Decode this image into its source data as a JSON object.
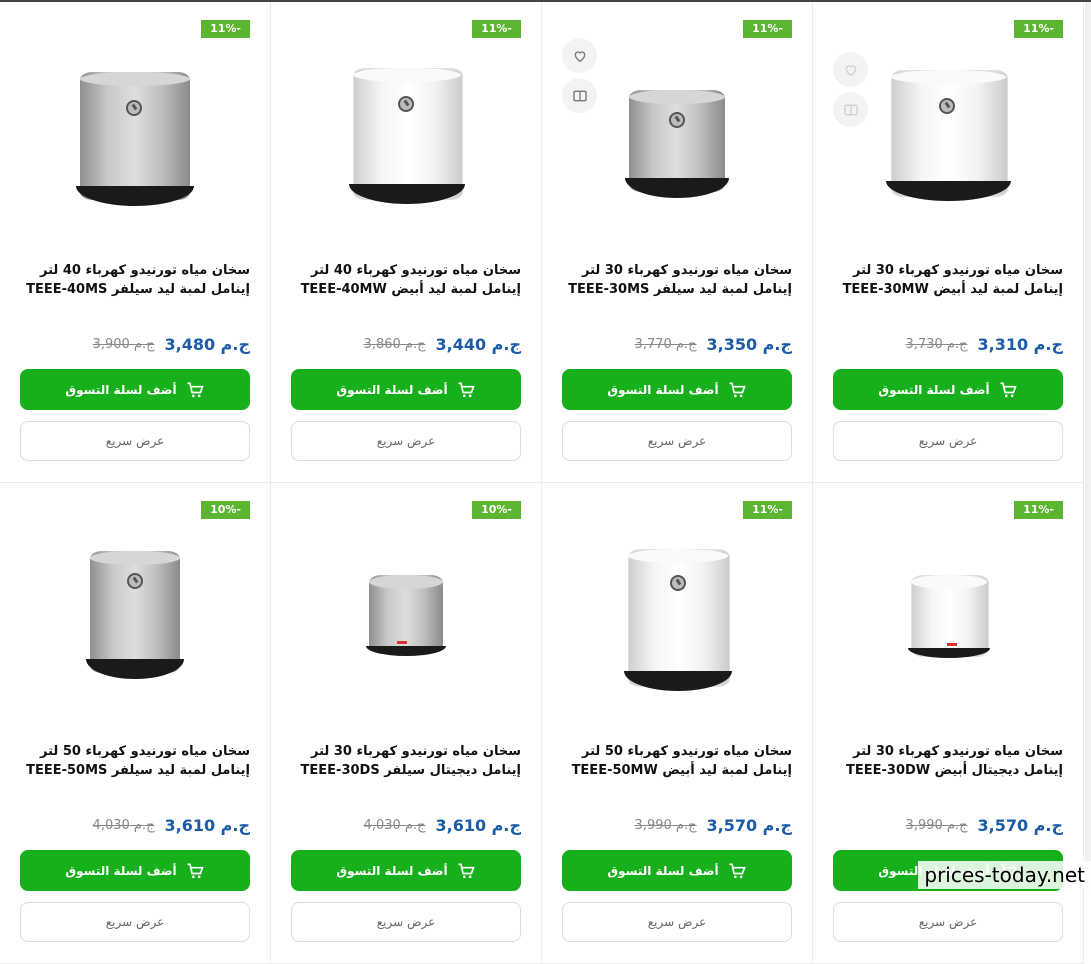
{
  "accent_color": "#17b01c",
  "badge_color": "#5cb531",
  "price_color": "#1b5ba8",
  "add_to_cart_label": "أضف لسلة التسوق",
  "quick_view_label": "عرض سريع",
  "watermark": "prices-today.net",
  "products": [
    {
      "discount": "11%-",
      "title": "سخان مياه تورنيدو كهرباء 30 لتر إينامل لمبة ليد أبيض TEEE-30MW",
      "price": "ج.م 3,310",
      "old_price": "ج.م 3,730",
      "color": "white"
    },
    {
      "discount": "11%-",
      "title": "سخان مياه تورنيدو كهرباء 30 لتر إينامل لمبة ليد سيلفر TEEE-30MS",
      "price": "ج.م 3,350",
      "old_price": "ج.م 3,770",
      "color": "silver"
    },
    {
      "discount": "11%-",
      "title": "سخان مياه تورنيدو كهرباء 40 لتر إينامل لمبة ليد أبيض TEEE-40MW",
      "price": "ج.م 3,440",
      "old_price": "ج.م 3,860",
      "color": "white"
    },
    {
      "discount": "11%-",
      "title": "سخان مياه تورنيدو كهرباء 40 لتر إينامل لمبة ليد سيلفر TEEE-40MS",
      "price": "ج.م 3,480",
      "old_price": "ج.م 3,900",
      "color": "silver"
    },
    {
      "discount": "11%-",
      "title": "سخان مياه تورنيدو كهرباء 30 لتر إينامل ديجيتال أبيض TEEE-30DW",
      "price": "ج.م 3,570",
      "old_price": "ج.م 3,990",
      "color": "white"
    },
    {
      "discount": "11%-",
      "title": "سخان مياه تورنيدو كهرباء 50 لتر إينامل لمبة ليد أبيض TEEE-50MW",
      "price": "ج.م 3,570",
      "old_price": "ج.م 3,990",
      "color": "white"
    },
    {
      "discount": "10%-",
      "title": "سخان مياه تورنيدو كهرباء 30 لتر إينامل ديجيتال سيلفر TEEE-30DS",
      "price": "ج.م 3,610",
      "old_price": "ج.م 4,030",
      "color": "silver"
    },
    {
      "discount": "10%-",
      "title": "سخان مياه تورنيدو كهرباء 50 لتر إينامل لمبة ليد سيلفر TEEE-50MS",
      "price": "ج.م 3,610",
      "old_price": "ج.م 4,030",
      "color": "silver"
    }
  ]
}
